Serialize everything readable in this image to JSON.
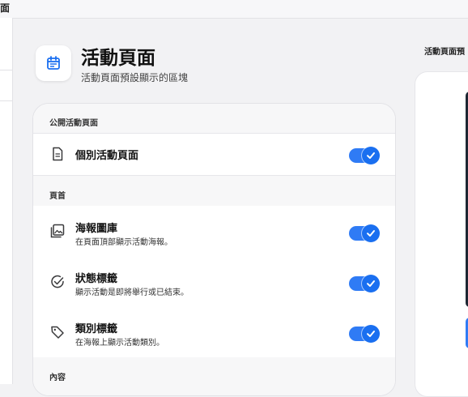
{
  "window": {
    "title_fragment": "面"
  },
  "header": {
    "icon": "calendar-icon",
    "title": "活動頁面",
    "subtitle": "活動頁面預設顯示的區塊"
  },
  "sections": {
    "public": {
      "label": "公開活動頁面",
      "rows": [
        {
          "icon": "document-icon",
          "title": "個別活動頁面",
          "enabled": true
        }
      ]
    },
    "homepage": {
      "label": "頁首",
      "rows": [
        {
          "icon": "image-gallery-icon",
          "title": "海報圖庫",
          "desc": "在頁面頂部顯示活動海報。",
          "enabled": true
        },
        {
          "icon": "check-circle-icon",
          "title": "狀態標籤",
          "desc": "顯示活動是即將舉行或已結束。",
          "enabled": true
        },
        {
          "icon": "tag-icon",
          "title": "類別標籤",
          "desc": "在海報上顯示活動類別。",
          "enabled": true
        }
      ]
    },
    "content": {
      "label": "內容"
    }
  },
  "preview": {
    "label": "活動頁面預"
  },
  "colors": {
    "accent": "#1a6ff0",
    "toggle_track": "#2f7bf5"
  }
}
